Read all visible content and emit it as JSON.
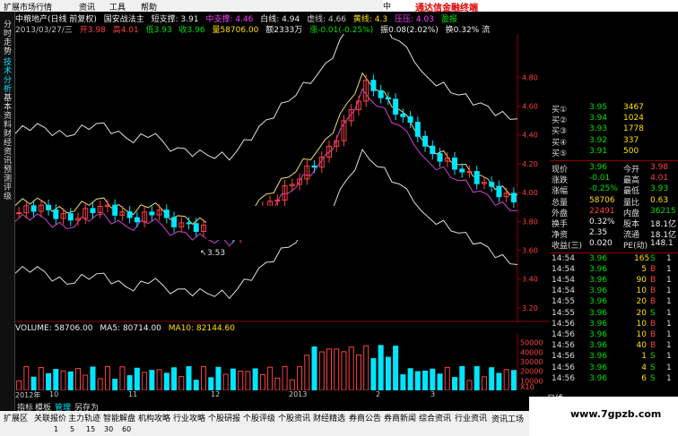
{
  "menu": [
    "扩展市场行情",
    "资讯",
    "工具",
    "帮助"
  ],
  "brand_title": "通达信金融终端",
  "brand_suffix": "中",
  "left_tabs": [
    {
      "label": "分时走势",
      "active": false
    },
    {
      "label": "技术分析",
      "active": true
    },
    {
      "label": "基本资料",
      "active": false
    },
    {
      "label": "财经资讯",
      "active": false
    },
    {
      "label": "预测评级",
      "active": false
    }
  ],
  "info1": {
    "stock": "中粮地产(日线 前复权)",
    "indicator": "国安战法主",
    "short_support": "短支撑: 3.91",
    "mid_support": "中支撑: 4.46",
    "white_line": "白线: 4.94",
    "dashed": "虚线: 4.66",
    "yellow_line": "黄线: 4.3",
    "pressure": "压压: 4.03",
    "profit": "盈报"
  },
  "info2": {
    "date": "2013/03/27/三",
    "open": "开3.98",
    "high": "高4.01",
    "low": "低3.93",
    "close": "收3.96",
    "volume": "量58706.00",
    "amount": "额2333万",
    "change": "涨-0.01(-0.25%)",
    "amplitude": "振0.08(2.02%)",
    "turnover": "换0.32% 流"
  },
  "price_axis": [
    "4.80",
    "4.60",
    "4.40",
    "4.20",
    "4.00",
    "3.80",
    "3.60",
    "3.40",
    "3.20"
  ],
  "low_annotation": "3.53",
  "volume_info": {
    "volume": "VOLUME: 58706.00",
    "ma5": "MA5: 80714.00",
    "ma10": "MA10: 82144.60"
  },
  "volume_axis": [
    "50000",
    "40000",
    "30000",
    "20000",
    "10000",
    "X10"
  ],
  "quote": {
    "asks": [
      {
        "label": "买①",
        "price": "3.95",
        "vol": "3467"
      },
      {
        "label": "买②",
        "price": "3.94",
        "vol": "1024"
      },
      {
        "label": "买③",
        "price": "3.93",
        "vol": "1778"
      },
      {
        "label": "买④",
        "price": "3.92",
        "vol": "337"
      },
      {
        "label": "买⑤",
        "price": "3.91",
        "vol": "500"
      }
    ],
    "stats": [
      {
        "l1": "现价",
        "v1": "3.96",
        "l2": "今开",
        "v2": "3.98",
        "c1": "#00e000",
        "c2": "#ff4040"
      },
      {
        "l1": "涨跌",
        "v1": "-0.01",
        "l2": "最高",
        "v2": "4.01",
        "c1": "#00e000",
        "c2": "#ff4040"
      },
      {
        "l1": "涨幅",
        "v1": "-0.25%",
        "l2": "最低",
        "v2": "3.93",
        "c1": "#00e000",
        "c2": "#00e000"
      },
      {
        "l1": "总量",
        "v1": "58706",
        "l2": "量比",
        "v2": "0.63",
        "c1": "#ffe000",
        "c2": "#ffe000"
      },
      {
        "l1": "外盘",
        "v1": "22491",
        "l2": "内盘",
        "v2": "36215",
        "c1": "#ff4040",
        "c2": "#00e000"
      },
      {
        "l1": "换手",
        "v1": "0.32%",
        "l2": "股本",
        "v2": "18.1亿",
        "c1": "#f0f0f0",
        "c2": "#f0f0f0"
      },
      {
        "l1": "净资",
        "v1": "2.35",
        "l2": "流通",
        "v2": "18.1亿",
        "c1": "#f0f0f0",
        "c2": "#f0f0f0"
      },
      {
        "l1": "收益(三)",
        "v1": "0.020",
        "l2": "PE(动)",
        "v2": "148.1",
        "c1": "#f0f0f0",
        "c2": "#f0f0f0"
      }
    ],
    "ticks": [
      {
        "time": "14:54",
        "price": "3.96",
        "vol": "165",
        "bs": "S",
        "n": "1"
      },
      {
        "time": "14:54",
        "price": "3.96",
        "vol": "5",
        "bs": "B",
        "n": "1"
      },
      {
        "time": "14:54",
        "price": "3.96",
        "vol": "90",
        "bs": "B",
        "n": "1"
      },
      {
        "time": "14:54",
        "price": "3.96",
        "vol": "10",
        "bs": "B",
        "n": "1"
      },
      {
        "time": "14:55",
        "price": "3.96",
        "vol": "20",
        "bs": "B",
        "n": "1"
      },
      {
        "time": "14:55",
        "price": "3.96",
        "vol": "20",
        "bs": "S",
        "n": "1"
      },
      {
        "time": "14:56",
        "price": "3.96",
        "vol": "10",
        "bs": "B",
        "n": "1"
      },
      {
        "time": "14:56",
        "price": "3.96",
        "vol": "10",
        "bs": "B",
        "n": "1"
      },
      {
        "time": "14:56",
        "price": "3.96",
        "vol": "40",
        "bs": "B",
        "n": "1"
      },
      {
        "time": "14:56",
        "price": "3.96",
        "vol": "1",
        "bs": "S",
        "n": "1"
      },
      {
        "time": "14:56",
        "price": "3.96",
        "vol": "4",
        "bs": "S",
        "n": "1"
      },
      {
        "time": "14:56",
        "price": "3.96",
        "vol": "6",
        "bs": "S",
        "n": "1"
      }
    ],
    "tab": "日线"
  },
  "toolbar": [
    "指标",
    "模板",
    "管理",
    "另存为"
  ],
  "date_labels": [
    "2012年",
    "10",
    "11",
    "12",
    "2013",
    "2",
    "3"
  ],
  "bottom_tabs": [
    "扩展区",
    "关联报价",
    "主力轨迹",
    "智能解盘",
    "机构攻略",
    "行业攻略",
    "个股研报",
    "个股评级",
    "个股资讯",
    "财经精选",
    "券商公告",
    "券商新闻",
    "综合资讯",
    "行业资讯",
    "资讯工场"
  ],
  "status_items": [
    "1",
    "5",
    "15",
    "30",
    "60"
  ],
  "watermark": "www.7gpzb.com",
  "colors": {
    "up": "#ff4040",
    "down": "#00e5ff",
    "ma_yellow": "#e8e070",
    "ma_magenta": "#d040d0",
    "band_white": "#e0e0e0",
    "grid_red": "#8b0000"
  }
}
